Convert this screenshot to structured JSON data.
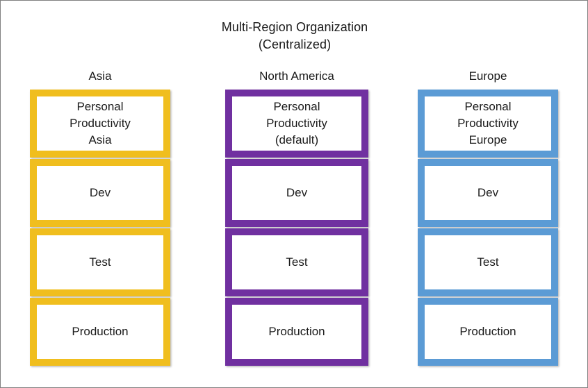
{
  "diagram": {
    "title_line1": "Multi-Region Organization",
    "title_line2": "(Centralized)",
    "frame_color": "#808080",
    "background": "#ffffff",
    "text_color": "#1a1a1a"
  },
  "columns": [
    {
      "id": "asia",
      "header": "Asia",
      "accent_color": "#F0BE1E",
      "boxes": [
        {
          "name": "personal-productivity",
          "line1": "Personal",
          "line2": "Productivity",
          "line3": "Asia"
        },
        {
          "name": "dev",
          "line1": "Dev",
          "line2": "",
          "line3": ""
        },
        {
          "name": "test",
          "line1": "Test",
          "line2": "",
          "line3": ""
        },
        {
          "name": "production",
          "line1": "Production",
          "line2": "",
          "line3": ""
        }
      ]
    },
    {
      "id": "north-america",
      "header": "North America",
      "accent_color": "#7030A0",
      "boxes": [
        {
          "name": "personal-productivity",
          "line1": "Personal",
          "line2": "Productivity",
          "line3": "(default)"
        },
        {
          "name": "dev",
          "line1": "Dev",
          "line2": "",
          "line3": ""
        },
        {
          "name": "test",
          "line1": "Test",
          "line2": "",
          "line3": ""
        },
        {
          "name": "production",
          "line1": "Production",
          "line2": "",
          "line3": ""
        }
      ]
    },
    {
      "id": "europe",
      "header": "Europe",
      "accent_color": "#5B9BD5",
      "boxes": [
        {
          "name": "personal-productivity",
          "line1": "Personal",
          "line2": "Productivity",
          "line3": "Europe"
        },
        {
          "name": "dev",
          "line1": "Dev",
          "line2": "",
          "line3": ""
        },
        {
          "name": "test",
          "line1": "Test",
          "line2": "",
          "line3": ""
        },
        {
          "name": "production",
          "line1": "Production",
          "line2": "",
          "line3": ""
        }
      ]
    }
  ]
}
